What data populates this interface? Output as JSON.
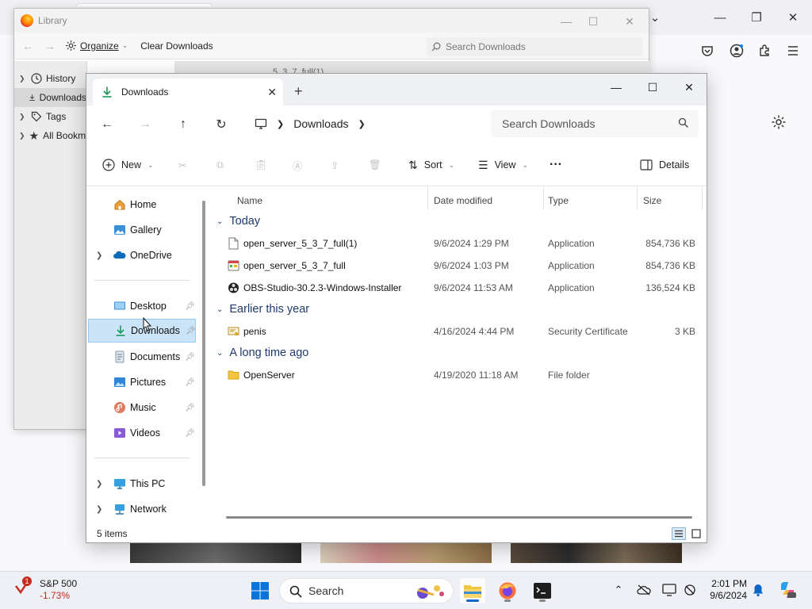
{
  "firefox": {
    "partial_tab_text": "5_3_7_full(1)"
  },
  "library": {
    "title": "Library",
    "organize": "Organize",
    "clear_downloads": "Clear Downloads",
    "search_placeholder": "Search Downloads",
    "sidebar": [
      {
        "label": "History",
        "icon": "clock-icon"
      },
      {
        "label": "Downloads",
        "icon": "download-icon",
        "selected": true
      },
      {
        "label": "Tags",
        "icon": "tag-icon"
      },
      {
        "label": "All Bookmarks",
        "icon": "star-icon"
      }
    ]
  },
  "explorer": {
    "tab_title": "Downloads",
    "breadcrumb": "Downloads",
    "search_placeholder": "Search Downloads",
    "commands": {
      "new": "New",
      "sort": "Sort",
      "view": "View",
      "details": "Details"
    },
    "nav": [
      {
        "label": "Home",
        "icon": "home-icon"
      },
      {
        "label": "Gallery",
        "icon": "gallery-icon"
      },
      {
        "label": "OneDrive",
        "icon": "onedrive-icon",
        "expandable": true
      },
      {
        "label": "Desktop",
        "icon": "desktop-icon",
        "pinned": true
      },
      {
        "label": "Downloads",
        "icon": "download-icon",
        "pinned": true,
        "selected": true
      },
      {
        "label": "Documents",
        "icon": "documents-icon",
        "pinned": true
      },
      {
        "label": "Pictures",
        "icon": "pictures-icon",
        "pinned": true
      },
      {
        "label": "Music",
        "icon": "music-icon",
        "pinned": true
      },
      {
        "label": "Videos",
        "icon": "videos-icon",
        "pinned": true
      },
      {
        "label": "This PC",
        "icon": "pc-icon",
        "expandable": true
      },
      {
        "label": "Network",
        "icon": "network-icon",
        "expandable": true
      }
    ],
    "columns": {
      "name": "Name",
      "date": "Date modified",
      "type": "Type",
      "size": "Size"
    },
    "groups": [
      {
        "label": "Today",
        "files": [
          {
            "name": "open_server_5_3_7_full(1)",
            "date": "9/6/2024 1:29 PM",
            "type": "Application",
            "size": "854,736 KB",
            "icon": "blank-file-icon"
          },
          {
            "name": "open_server_5_3_7_full",
            "date": "9/6/2024 1:03 PM",
            "type": "Application",
            "size": "854,736 KB",
            "icon": "app-file-icon"
          },
          {
            "name": "OBS-Studio-30.2.3-Windows-Installer",
            "date": "9/6/2024 11:53 AM",
            "type": "Application",
            "size": "136,524 KB",
            "icon": "obs-icon"
          }
        ]
      },
      {
        "label": "Earlier this year",
        "files": [
          {
            "name": "penis",
            "date": "4/16/2024 4:44 PM",
            "type": "Security Certificate",
            "size": "3 KB",
            "icon": "certificate-icon"
          }
        ]
      },
      {
        "label": "A long time ago",
        "files": [
          {
            "name": "OpenServer",
            "date": "4/19/2020 11:18 AM",
            "type": "File folder",
            "size": "",
            "icon": "folder-icon"
          }
        ]
      }
    ],
    "status": "5 items"
  },
  "taskbar": {
    "widget_name": "S&P 500",
    "widget_change": "-1.73%",
    "widget_badge": "1",
    "search_label": "Search",
    "time": "2:01 PM",
    "date": "9/6/2024",
    "colors": {
      "negative": "#c42b1c",
      "accent": "#0a67c8"
    }
  }
}
